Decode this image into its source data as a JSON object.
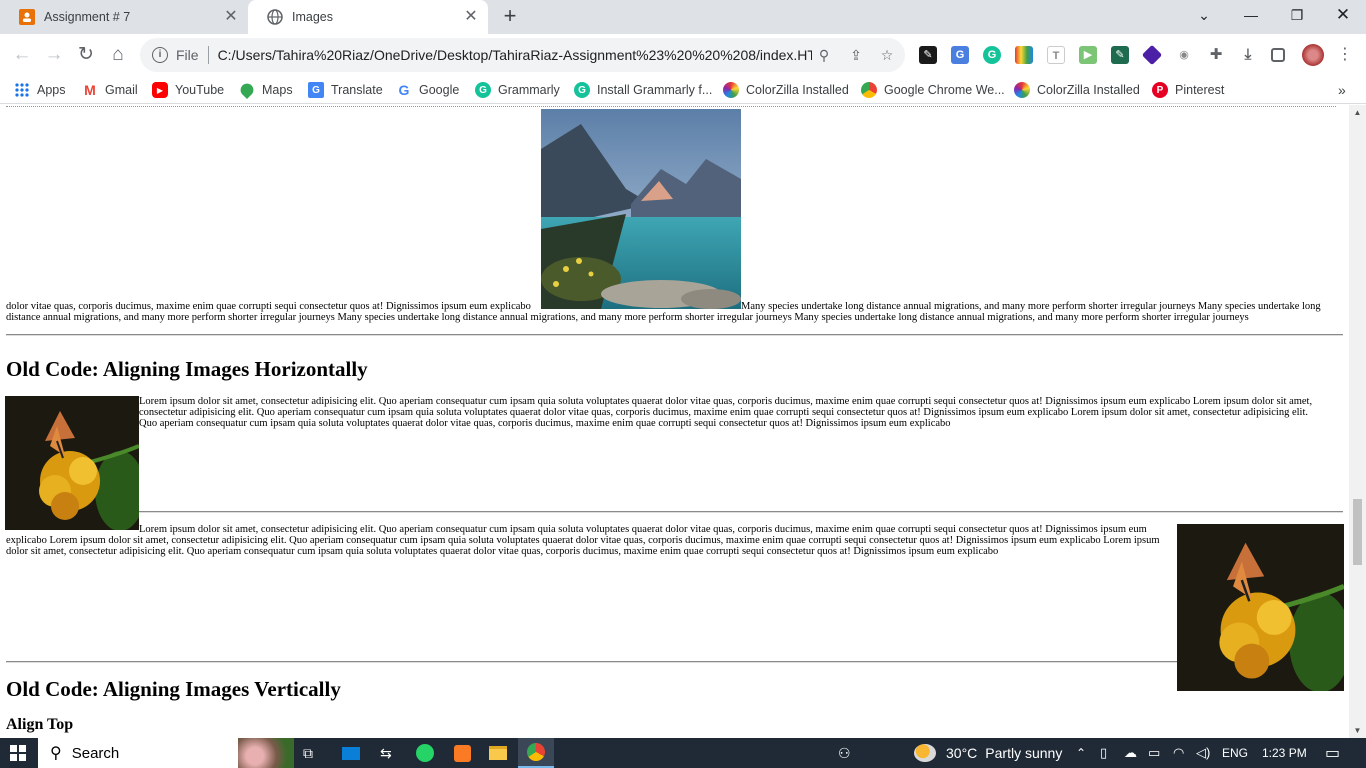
{
  "tabs": [
    {
      "title": "Assignment # 7"
    },
    {
      "title": "Images"
    }
  ],
  "address": {
    "scheme_label": "File",
    "url": "C:/Users/Tahira%20Riaz/OneDrive/Desktop/TahiraRiaz-Assignment%23%20%20%208/index.HT..."
  },
  "bookmarks": [
    {
      "label": "Apps",
      "icon": "apps-grid-icon"
    },
    {
      "label": "Gmail",
      "icon": "gmail-icon"
    },
    {
      "label": "YouTube",
      "icon": "youtube-icon"
    },
    {
      "label": "Maps",
      "icon": "maps-icon"
    },
    {
      "label": "Translate",
      "icon": "translate-icon"
    },
    {
      "label": "Google",
      "icon": "google-icon"
    },
    {
      "label": "Grammarly",
      "icon": "grammarly-icon"
    },
    {
      "label": "Install Grammarly f...",
      "icon": "grammarly-icon"
    },
    {
      "label": "ColorZilla Installed",
      "icon": "colorzilla-icon"
    },
    {
      "label": "Google Chrome We...",
      "icon": "chrome-icon"
    },
    {
      "label": "ColorZilla Installed",
      "icon": "colorzilla-icon"
    },
    {
      "label": "Pinterest",
      "icon": "pinterest-icon"
    }
  ],
  "page": {
    "p1_before": "dolor vitae quas, corporis ducimus, maxime enim quae corrupti sequi consectetur quos at! Dignissimos ipsum eum explicabo",
    "p1_after_line1": "Many species undertake long distance annual migrations, and many more perform shorter irregular journeys Many species undertake long",
    "p1_after_line2": "distance annual migrations, and many more perform shorter irregular journeys Many species undertake long distance annual migrations, and many more perform shorter irregular journeys Many species undertake long distance annual migrations, and many more perform shorter irregular journeys",
    "heading_horizontal": "Old Code: Aligning Images Horizontally",
    "p2_line1": "Lorem ipsum dolor sit amet, consectetur adipisicing elit. Quo aperiam consequatur cum ipsam quia soluta voluptates quaerat dolor vitae quas, corporis ducimus, maxime enim quae corrupti sequi consectetur quos at! Dignissimos ipsum eum explicabo Lorem ipsum dolor sit amet,",
    "p2_line2": "consectetur adipisicing elit. Quo aperiam consequatur cum ipsam quia soluta voluptates quaerat dolor vitae quas, corporis ducimus, maxime enim quae corrupti sequi consectetur quos at! Dignissimos ipsum eum explicabo Lorem ipsum dolor sit amet, consectetur adipisicing elit.",
    "p2_line3": "Quo aperiam consequatur cum ipsam quia soluta voluptates quaerat dolor vitae quas, corporis ducimus, maxime enim quae corrupti sequi consectetur quos at! Dignissimos ipsum eum explicabo",
    "p3_line1": "Lorem ipsum dolor sit amet, consectetur adipisicing elit. Quo aperiam consequatur cum ipsam quia soluta voluptates quaerat dolor vitae quas, corporis ducimus, maxime enim quae corrupti sequi consectetur quos at! Dignissimos ipsum eum",
    "p3_line2": "explicabo Lorem ipsum dolor sit amet, consectetur adipisicing elit. Quo aperiam consequatur cum ipsam quia soluta voluptates quaerat dolor vitae quas, corporis ducimus, maxime enim quae corrupti sequi consectetur quos at! Dignissimos ipsum eum explicabo Lorem ipsum",
    "p3_line3": "dolor sit amet, consectetur adipisicing elit. Quo aperiam consequatur cum ipsam quia soluta voluptates quaerat dolor vitae quas, corporis ducimus, maxime enim quae corrupti sequi consectetur quos at! Dignissimos ipsum eum explicabo",
    "heading_vertical": "Old Code: Aligning Images Vertically",
    "subheading_align_top": "Align Top"
  },
  "taskbar": {
    "search_label": "Search",
    "weather_temp": "30°C",
    "weather_desc": "Partly sunny",
    "language": "ENG",
    "time": "1:23 PM"
  }
}
